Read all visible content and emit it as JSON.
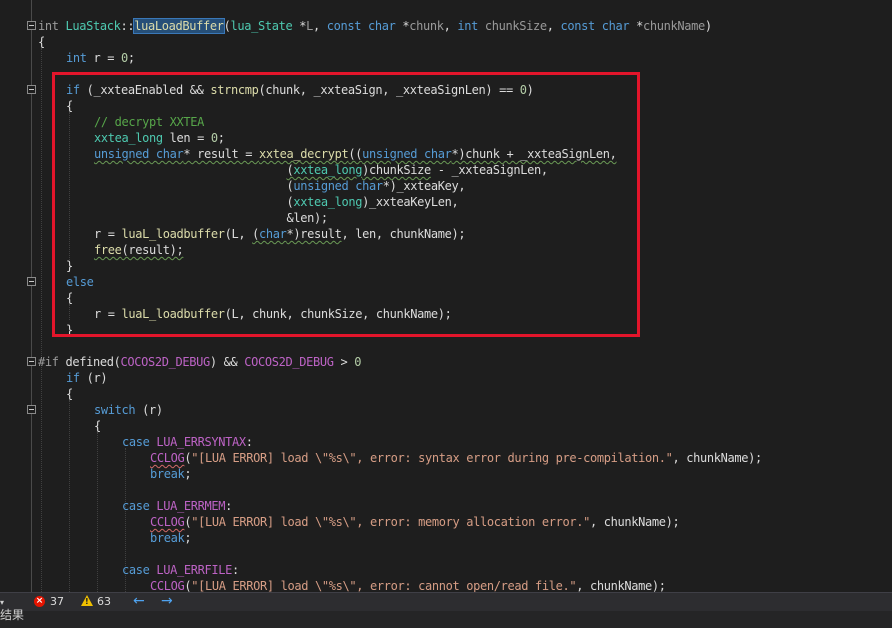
{
  "code_lines": [
    {
      "segments": [
        {
          "c": "pm",
          "t": "int "
        },
        {
          "c": "ty",
          "t": "LuaStack"
        },
        {
          "c": "va",
          "t": "::"
        },
        {
          "c": "fn hl",
          "t": "luaLoadBuffer"
        },
        {
          "c": "va",
          "t": "("
        },
        {
          "c": "ty",
          "t": "lua_State"
        },
        {
          "c": "va",
          "t": " *"
        },
        {
          "c": "pm",
          "t": "L"
        },
        {
          "c": "va",
          "t": ", "
        },
        {
          "c": "kw",
          "t": "const char"
        },
        {
          "c": "va",
          "t": " *"
        },
        {
          "c": "pm",
          "t": "chunk"
        },
        {
          "c": "va",
          "t": ", "
        },
        {
          "c": "kw",
          "t": "int"
        },
        {
          "c": "va",
          "t": " "
        },
        {
          "c": "pm",
          "t": "chunkSize"
        },
        {
          "c": "va",
          "t": ", "
        },
        {
          "c": "kw",
          "t": "const char"
        },
        {
          "c": "va",
          "t": " *"
        },
        {
          "c": "pm",
          "t": "chunkName"
        },
        {
          "c": "va",
          "t": ")"
        }
      ]
    },
    {
      "segments": [
        {
          "c": "va",
          "t": "{"
        }
      ]
    },
    {
      "segments": [
        {
          "c": "kw",
          "t": "int"
        },
        {
          "c": "va",
          "t": " r = "
        },
        {
          "c": "num",
          "t": "0"
        },
        {
          "c": "va",
          "t": ";"
        }
      ]
    },
    {
      "segments": []
    },
    {
      "segments": [
        {
          "c": "kw",
          "t": "if"
        },
        {
          "c": "va",
          "t": " (_xxteaEnabled && "
        },
        {
          "c": "fn",
          "t": "strncmp"
        },
        {
          "c": "va",
          "t": "(chunk, _xxteaSign, _xxteaSignLen) == "
        },
        {
          "c": "num",
          "t": "0"
        },
        {
          "c": "va",
          "t": ")"
        }
      ]
    },
    {
      "segments": [
        {
          "c": "va",
          "t": "{"
        }
      ]
    },
    {
      "segments": [
        {
          "c": "cm",
          "t": "// decrypt XXTEA"
        }
      ]
    },
    {
      "segments": [
        {
          "c": "ty",
          "t": "xxtea_long"
        },
        {
          "c": "va",
          "t": " len = "
        },
        {
          "c": "num",
          "t": "0"
        },
        {
          "c": "va",
          "t": ";"
        }
      ]
    },
    {
      "segments": [
        {
          "c": "kw squig-g",
          "t": "unsigned char"
        },
        {
          "c": "va squig-g",
          "t": "* result = "
        },
        {
          "c": "fn squig-g",
          "t": "xxtea_decrypt"
        },
        {
          "c": "va squig-g",
          "t": "(("
        },
        {
          "c": "kw squig-g",
          "t": "unsigned char"
        },
        {
          "c": "va squig-g",
          "t": "*)chunk + _xxteaSignLen,"
        }
      ]
    },
    {
      "segments": [
        {
          "c": "va",
          "t": "                            "
        },
        {
          "c": "va squig-g",
          "t": "("
        },
        {
          "c": "ty squig-g",
          "t": "xxtea_long"
        },
        {
          "c": "va squig-g",
          "t": ")chunkSize"
        },
        {
          "c": "va",
          "t": " - _xxteaSignLen,"
        }
      ]
    },
    {
      "segments": [
        {
          "c": "va",
          "t": "                            ("
        },
        {
          "c": "kw",
          "t": "unsigned char"
        },
        {
          "c": "va",
          "t": "*)_xxteaKey,"
        }
      ]
    },
    {
      "segments": [
        {
          "c": "va",
          "t": "                            ("
        },
        {
          "c": "ty",
          "t": "xxtea_long"
        },
        {
          "c": "va",
          "t": ")_xxteaKeyLen,"
        }
      ]
    },
    {
      "segments": [
        {
          "c": "va",
          "t": "                            &len);"
        }
      ]
    },
    {
      "segments": [
        {
          "c": "va",
          "t": "r = "
        },
        {
          "c": "fn",
          "t": "luaL_loadbuffer"
        },
        {
          "c": "va",
          "t": "(L, "
        },
        {
          "c": "va squig-g",
          "t": "("
        },
        {
          "c": "kw squig-g",
          "t": "char"
        },
        {
          "c": "va squig-g",
          "t": "*)result"
        },
        {
          "c": "va",
          "t": ", len, chunkName);"
        }
      ]
    },
    {
      "segments": [
        {
          "c": "fn squig-g",
          "t": "free"
        },
        {
          "c": "va squig-g",
          "t": "(result);"
        }
      ]
    },
    {
      "segments": [
        {
          "c": "va",
          "t": "}"
        }
      ]
    },
    {
      "segments": [
        {
          "c": "kw",
          "t": "else"
        }
      ]
    },
    {
      "segments": [
        {
          "c": "va",
          "t": "{"
        }
      ]
    },
    {
      "segments": [
        {
          "c": "va",
          "t": "r = "
        },
        {
          "c": "fn",
          "t": "luaL_loadbuffer"
        },
        {
          "c": "va",
          "t": "(L, chunk, chunkSize, chunkName);"
        }
      ]
    },
    {
      "segments": [
        {
          "c": "va",
          "t": "}"
        }
      ]
    },
    {
      "segments": []
    },
    {
      "segments": [
        {
          "c": "pp",
          "t": "#if "
        },
        {
          "c": "va",
          "t": "defined("
        },
        {
          "c": "mc",
          "t": "COCOS2D_DEBUG"
        },
        {
          "c": "va",
          "t": ") && "
        },
        {
          "c": "mc",
          "t": "COCOS2D_DEBUG"
        },
        {
          "c": "va",
          "t": " > "
        },
        {
          "c": "num",
          "t": "0"
        }
      ]
    },
    {
      "segments": [
        {
          "c": "kw",
          "t": "if"
        },
        {
          "c": "va",
          "t": " (r)"
        }
      ]
    },
    {
      "segments": [
        {
          "c": "va",
          "t": "{"
        }
      ]
    },
    {
      "segments": [
        {
          "c": "kw",
          "t": "switch"
        },
        {
          "c": "va",
          "t": " (r)"
        }
      ]
    },
    {
      "segments": [
        {
          "c": "va",
          "t": "{"
        }
      ]
    },
    {
      "segments": [
        {
          "c": "kw",
          "t": "case "
        },
        {
          "c": "mc",
          "t": "LUA_ERRSYNTAX"
        },
        {
          "c": "va",
          "t": ":"
        }
      ]
    },
    {
      "segments": [
        {
          "c": "mc squig",
          "t": "CCLOG"
        },
        {
          "c": "va",
          "t": "("
        },
        {
          "c": "str",
          "t": "\"[LUA ERROR] load \\\"%s\\\", error: syntax error during pre-compilation.\""
        },
        {
          "c": "va",
          "t": ", chunkName);"
        }
      ]
    },
    {
      "segments": [
        {
          "c": "kw",
          "t": "break"
        },
        {
          "c": "va",
          "t": ";"
        }
      ]
    },
    {
      "segments": []
    },
    {
      "segments": [
        {
          "c": "kw",
          "t": "case "
        },
        {
          "c": "mc",
          "t": "LUA_ERRMEM"
        },
        {
          "c": "va",
          "t": ":"
        }
      ]
    },
    {
      "segments": [
        {
          "c": "mc squig",
          "t": "CCLOG"
        },
        {
          "c": "va",
          "t": "("
        },
        {
          "c": "str",
          "t": "\"[LUA ERROR] load \\\"%s\\\", error: memory allocation error.\""
        },
        {
          "c": "va",
          "t": ", chunkName);"
        }
      ]
    },
    {
      "segments": [
        {
          "c": "kw",
          "t": "break"
        },
        {
          "c": "va",
          "t": ";"
        }
      ]
    },
    {
      "segments": []
    },
    {
      "segments": [
        {
          "c": "kw",
          "t": "case "
        },
        {
          "c": "mc",
          "t": "LUA_ERRFILE"
        },
        {
          "c": "va",
          "t": ":"
        }
      ]
    },
    {
      "segments": [
        {
          "c": "mc squig",
          "t": "CCLOG"
        },
        {
          "c": "va",
          "t": "("
        },
        {
          "c": "str",
          "t": "\"[LUA ERROR] load \\\"%s\\\", error: cannot open/read file.\""
        },
        {
          "c": "va",
          "t": ", chunkName);"
        }
      ]
    }
  ],
  "statusbar": {
    "errors": "37",
    "warnings": "63",
    "back_icon": "arrow-left-icon",
    "forward_icon": "arrow-right-icon"
  },
  "bottom_panel": {
    "label": "结果"
  }
}
